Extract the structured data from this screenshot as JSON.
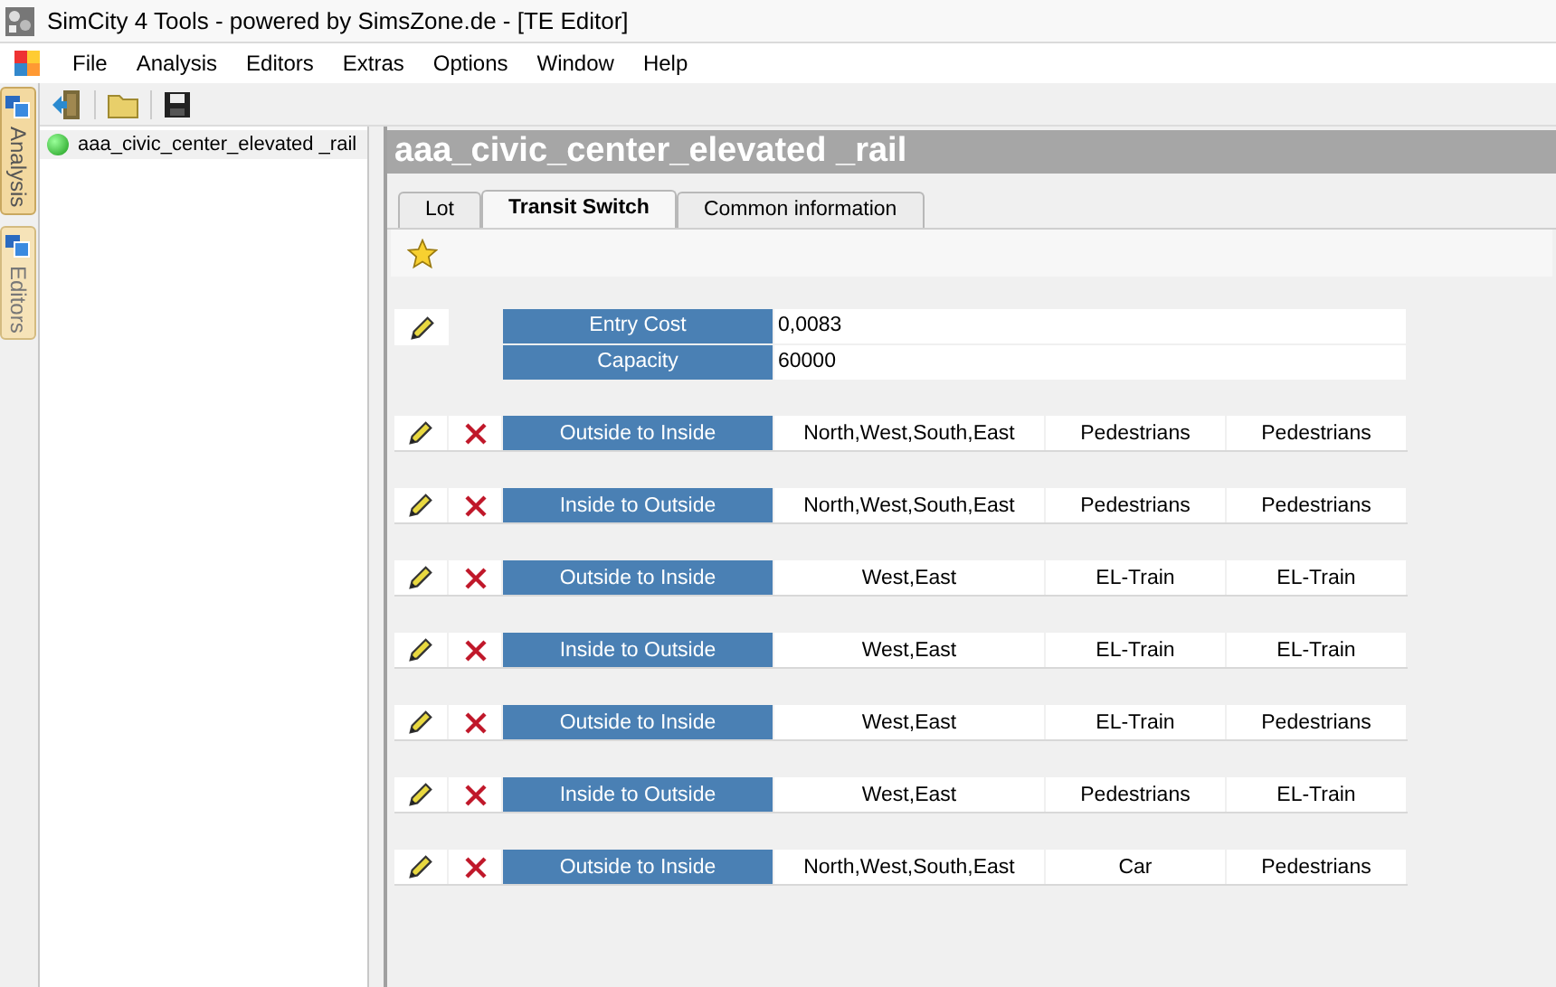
{
  "window": {
    "title": "SimCity 4 Tools - powered by SimsZone.de - [TE Editor]"
  },
  "menu": [
    "File",
    "Analysis",
    "Editors",
    "Extras",
    "Options",
    "Window",
    "Help"
  ],
  "side_tabs": [
    {
      "label": "Analysis",
      "selected": true
    },
    {
      "label": "Editors",
      "selected": false
    }
  ],
  "tree": {
    "items": [
      {
        "label": "aaa_civic_center_elevated _rail",
        "selected": true
      }
    ]
  },
  "editor": {
    "title": "aaa_civic_center_elevated _rail",
    "tabs": [
      {
        "label": "Lot",
        "selected": false
      },
      {
        "label": "Transit Switch",
        "selected": true
      },
      {
        "label": "Common information",
        "selected": false
      }
    ],
    "properties": [
      {
        "label": "Entry Cost",
        "value": "0,0083"
      },
      {
        "label": "Capacity",
        "value": "60000"
      }
    ],
    "switches": [
      {
        "direction": "Outside to Inside",
        "sides": "North,West,South,East",
        "from": "Pedestrians",
        "to": "Pedestrians"
      },
      {
        "direction": "Inside to Outside",
        "sides": "North,West,South,East",
        "from": "Pedestrians",
        "to": "Pedestrians"
      },
      {
        "direction": "Outside to Inside",
        "sides": "West,East",
        "from": "EL-Train",
        "to": "EL-Train"
      },
      {
        "direction": "Inside to Outside",
        "sides": "West,East",
        "from": "EL-Train",
        "to": "EL-Train"
      },
      {
        "direction": "Outside to Inside",
        "sides": "West,East",
        "from": "EL-Train",
        "to": "Pedestrians"
      },
      {
        "direction": "Inside to Outside",
        "sides": "West,East",
        "from": "Pedestrians",
        "to": "EL-Train"
      },
      {
        "direction": "Outside to Inside",
        "sides": "North,West,South,East",
        "from": "Car",
        "to": "Pedestrians"
      }
    ]
  }
}
